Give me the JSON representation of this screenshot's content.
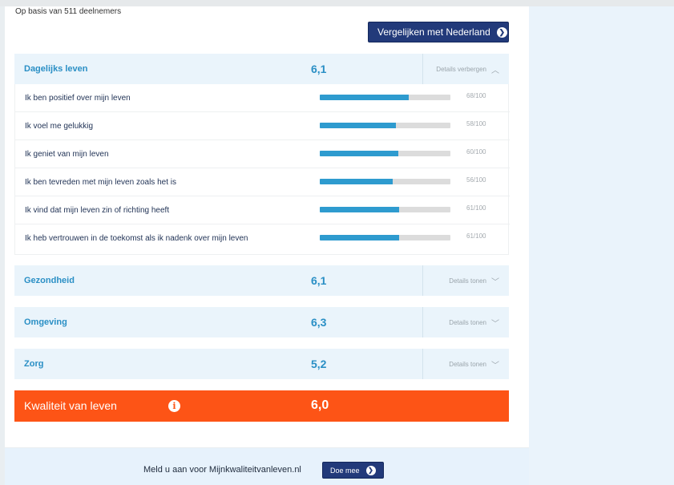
{
  "header": {
    "participants": "Op basis van 511 deelnemers",
    "compare_label": "Vergelijken met Nederland",
    "compare_icon": "circle-arrow-right-icon"
  },
  "sections": [
    {
      "title": "Dagelijks leven",
      "score": "6,1",
      "details_label": "Details verbergen",
      "expanded": true,
      "rows": [
        {
          "label": "Ik ben positief over mijn leven",
          "value": 68,
          "value_text": "68/100"
        },
        {
          "label": "Ik voel me gelukkig",
          "value": 58,
          "value_text": "58/100"
        },
        {
          "label": "Ik geniet van mijn leven",
          "value": 60,
          "value_text": "60/100"
        },
        {
          "label": "Ik ben tevreden met mijn leven zoals het is",
          "value": 56,
          "value_text": "56/100"
        },
        {
          "label": "Ik vind dat mijn leven zin of richting heeft",
          "value": 61,
          "value_text": "61/100"
        },
        {
          "label": "Ik heb vertrouwen in de toekomst als ik nadenk over mijn leven",
          "value": 61,
          "value_text": "61/100"
        }
      ]
    },
    {
      "title": "Gezondheid",
      "score": "6,1",
      "details_label": "Details tonen",
      "expanded": false
    },
    {
      "title": "Omgeving",
      "score": "6,3",
      "details_label": "Details tonen",
      "expanded": false
    },
    {
      "title": "Zorg",
      "score": "5,2",
      "details_label": "Details tonen",
      "expanded": false
    }
  ],
  "total": {
    "title": "Kwaliteit van leven",
    "score": "6,0",
    "info_icon": "info-icon"
  },
  "footer": {
    "signup_text": "Meld u aan voor Mijnkwaliteitvanleven.nl",
    "join_label": "Doe mee"
  },
  "colors": {
    "accent_blue": "#2a8fc5",
    "bar_fill": "#2e9bcf",
    "button_navy": "#223a7a",
    "total_orange": "#fd5416"
  }
}
